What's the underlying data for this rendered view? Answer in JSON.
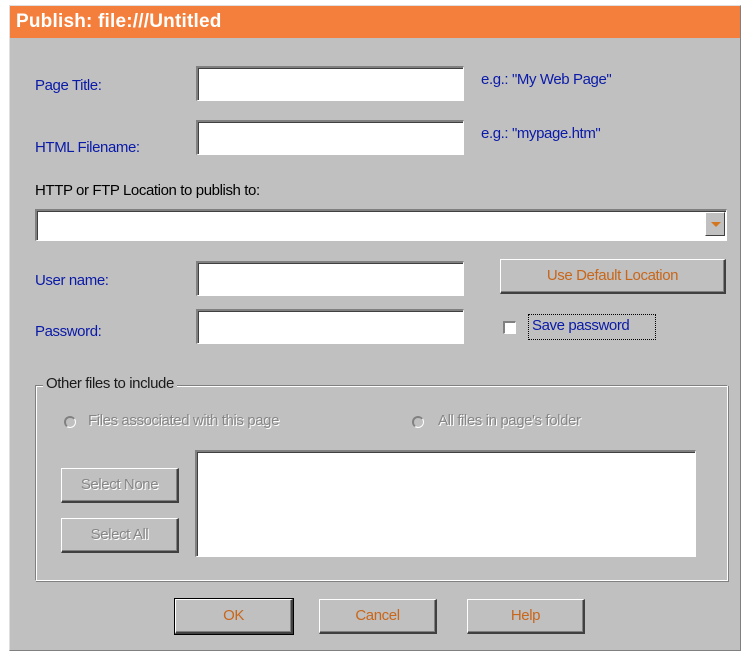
{
  "window": {
    "title": "Publish: file:///Untitled"
  },
  "form": {
    "page_title": {
      "label": "Page Title:",
      "value": "",
      "hint": "e.g.: \"My Web Page\""
    },
    "html_filename": {
      "label": "HTML Filename:",
      "value": "",
      "hint": "e.g.: \"mypage.htm\""
    },
    "location": {
      "label": "HTTP or FTP Location to publish to:",
      "value": ""
    },
    "user_name": {
      "label": "User name:",
      "value": ""
    },
    "password": {
      "label": "Password:",
      "value": ""
    },
    "use_default_location_label": "Use Default Location",
    "save_password_label": "Save password",
    "save_password_checked": false
  },
  "other_files": {
    "title": "Other files to include",
    "radio_associated": "Files associated with this page",
    "radio_all_folder": "All files in page's folder",
    "select_none_label": "Select None",
    "select_all_label": "Select All",
    "files": []
  },
  "buttons": {
    "ok": "OK",
    "cancel": "Cancel",
    "help": "Help"
  },
  "colors": {
    "title_bar": "#f47f3c",
    "label_text": "#0a1aa8",
    "button_text": "#c8661a",
    "disabled_text": "#868686"
  }
}
